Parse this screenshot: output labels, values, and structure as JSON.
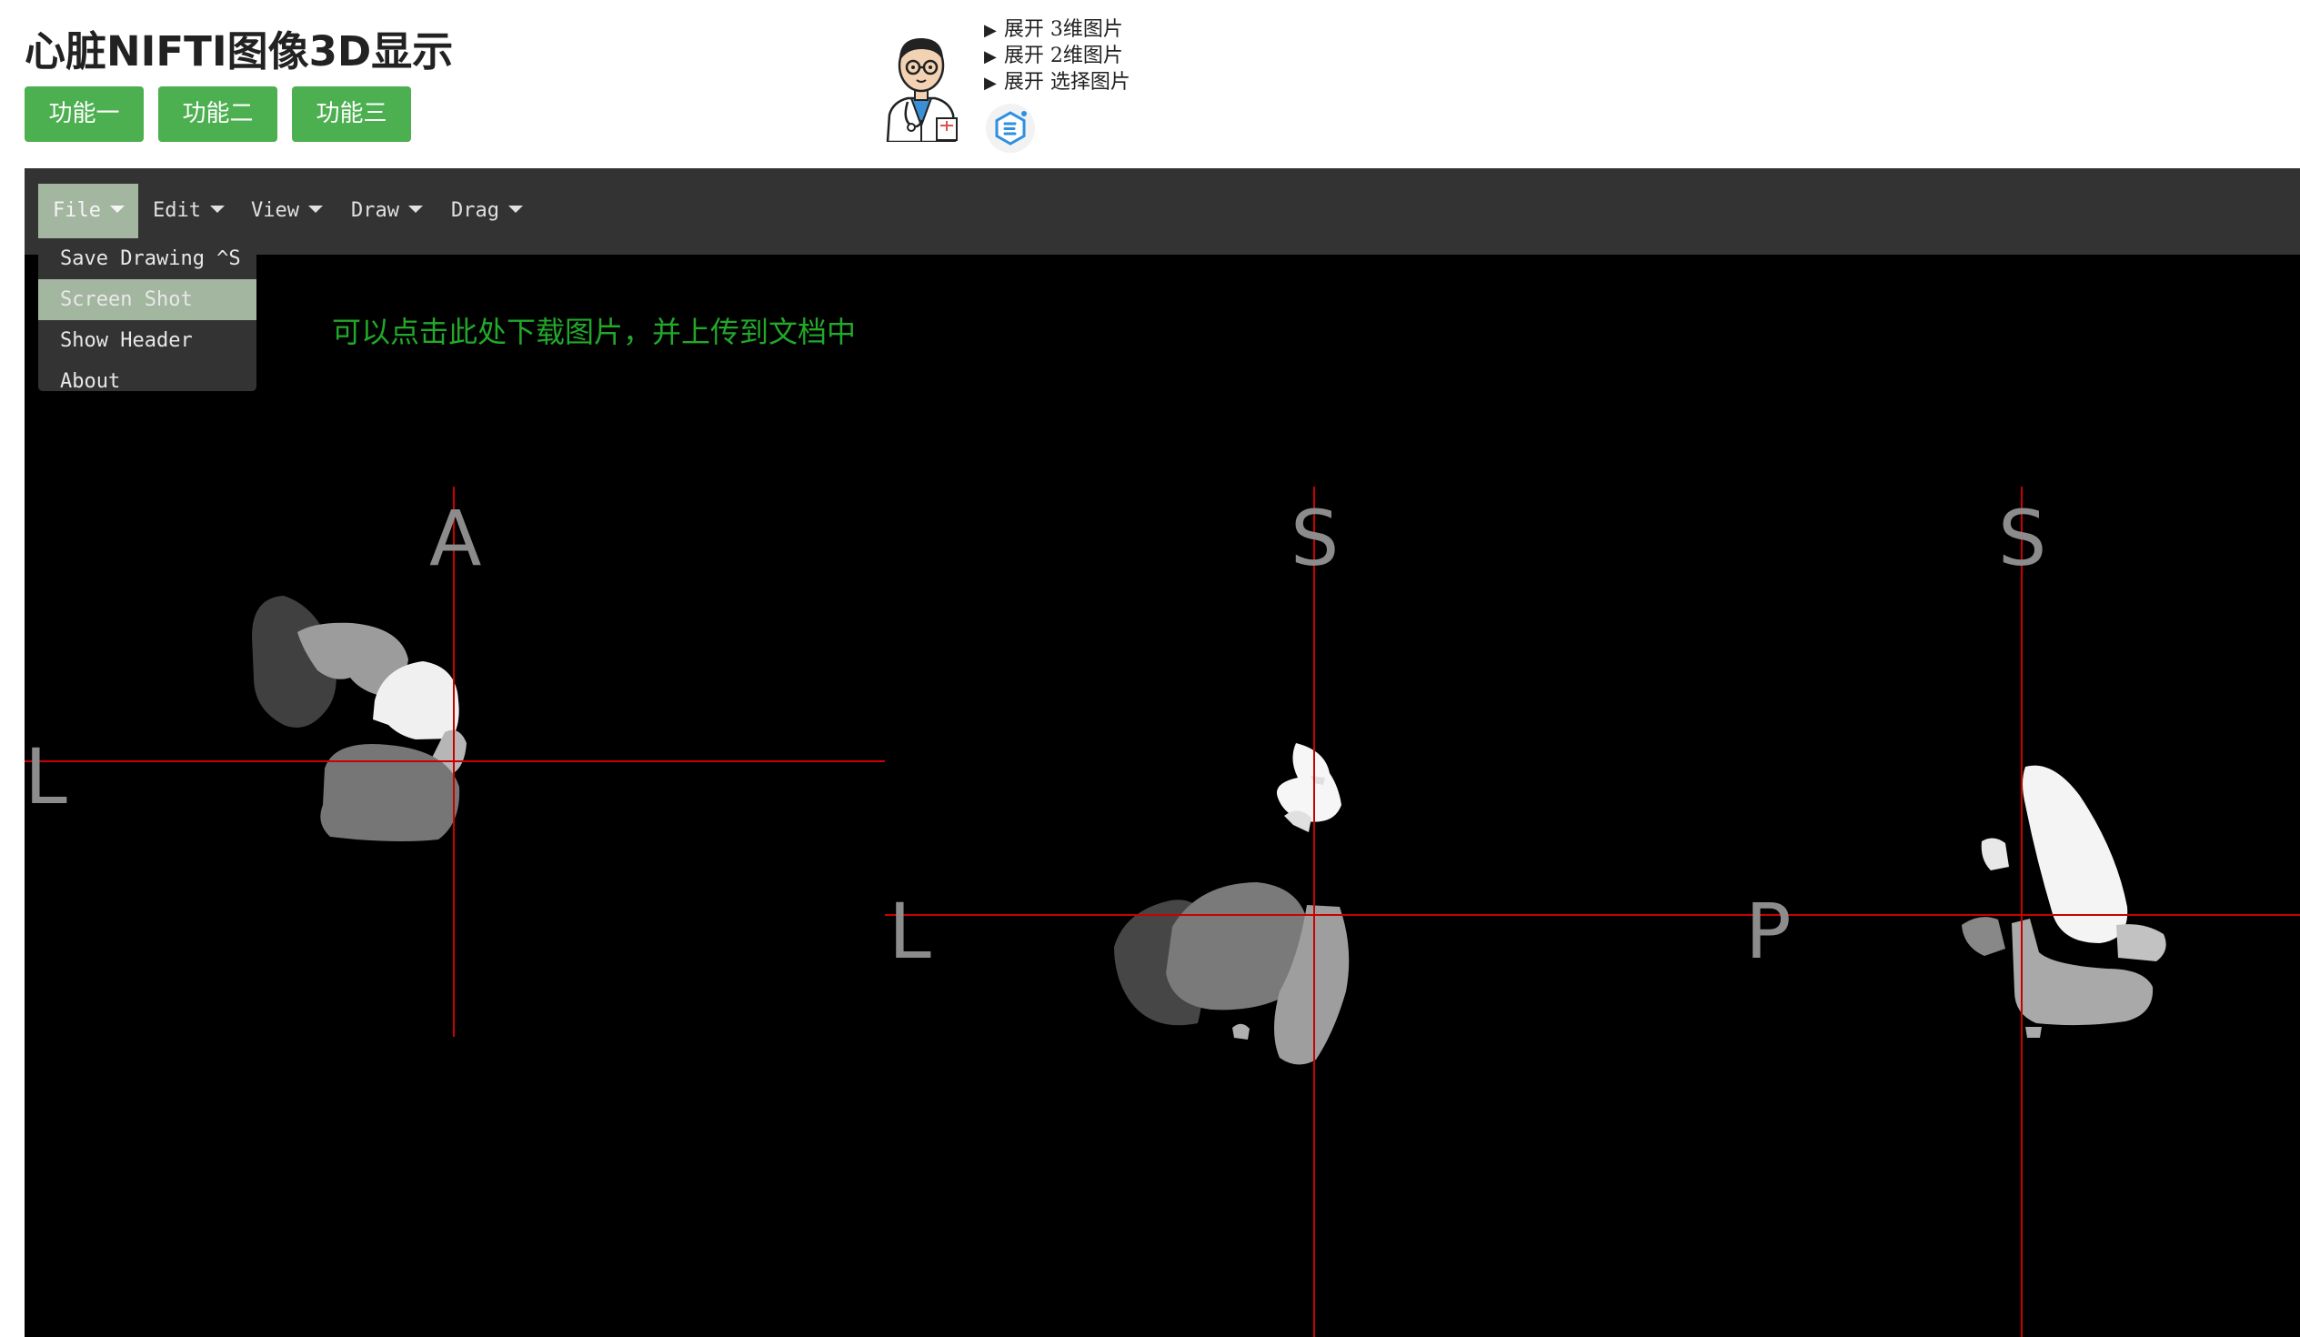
{
  "header": {
    "title": "心脏NIFTI图像3D显示",
    "buttons": [
      "功能一",
      "功能二",
      "功能三"
    ],
    "expanders": [
      {
        "marker": "▶",
        "label": "展开 3维图片"
      },
      {
        "marker": "▶",
        "label": "展开 2维图片"
      },
      {
        "marker": "▶",
        "label": "展开 选择图片"
      }
    ]
  },
  "menubar": {
    "items": [
      {
        "label": "File",
        "active": true
      },
      {
        "label": "Edit",
        "active": false
      },
      {
        "label": "View",
        "active": false
      },
      {
        "label": "Draw",
        "active": false
      },
      {
        "label": "Drag",
        "active": false
      }
    ],
    "file_menu": [
      {
        "label": "Save Drawing ^S",
        "highlighted": false
      },
      {
        "label": "Screen Shot",
        "highlighted": true
      },
      {
        "label": "Show Header",
        "highlighted": false
      },
      {
        "label": "About",
        "highlighted": false
      }
    ]
  },
  "viewer": {
    "hint": "可以点击此处下载图片，并上传到文档中",
    "views": [
      {
        "name": "axial",
        "top_label": "A",
        "left_label": "L"
      },
      {
        "name": "coronal",
        "top_label": "S",
        "left_label": "L"
      },
      {
        "name": "sagittal",
        "top_label": "S",
        "left_label": "P"
      }
    ],
    "crosshair_color": "#cc0000"
  },
  "colors": {
    "accent_button": "#4caf50",
    "menu_bg": "#333333",
    "menu_active": "#a3b6a0",
    "hint_text": "#22a82a"
  },
  "icons": [
    "doctor-avatar-icon",
    "e-logo-icon",
    "caret-down-icon"
  ]
}
